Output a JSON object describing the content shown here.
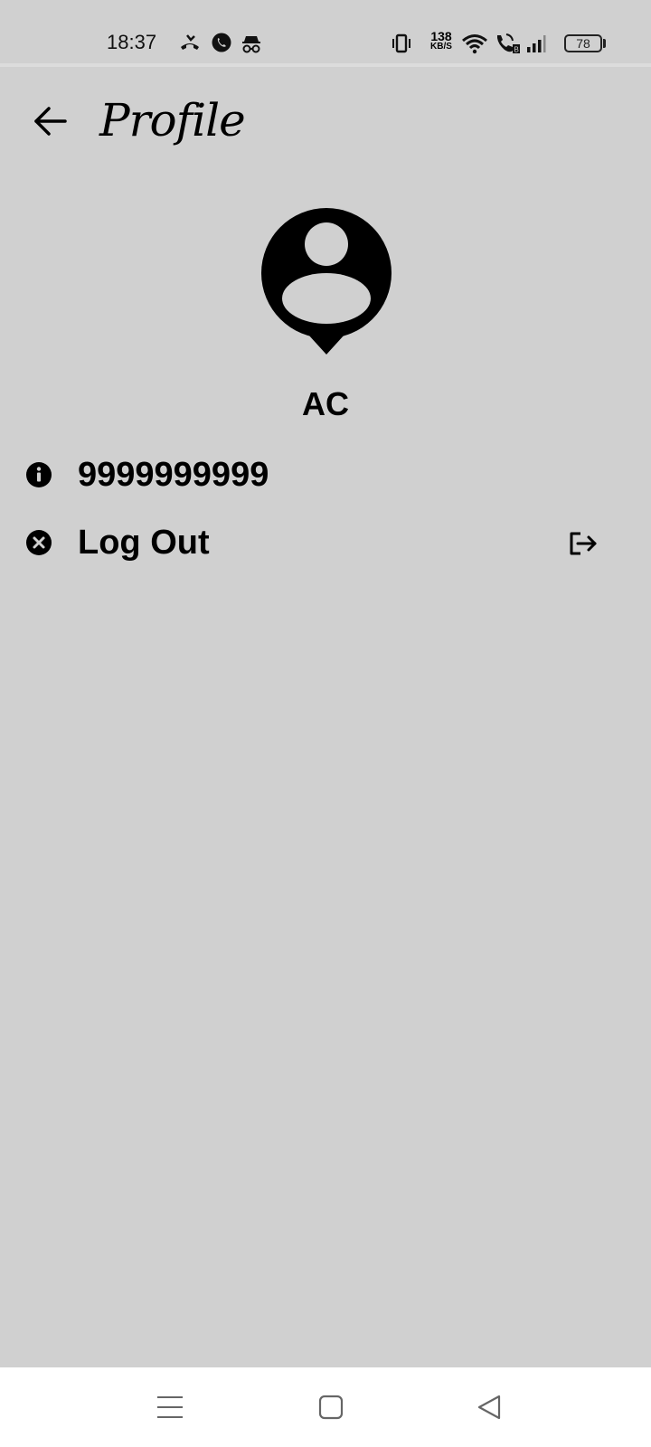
{
  "status_bar": {
    "time": "18:37",
    "net_speed_value": "138",
    "net_speed_unit": "KB/S",
    "battery": "78",
    "icons": [
      "missed-call-icon",
      "whatsapp-icon",
      "incognito-icon",
      "vibrate-icon",
      "wifi-icon",
      "volte-call-icon",
      "signal-icon",
      "battery-icon"
    ]
  },
  "header": {
    "title": "Profile",
    "back_icon": "arrow-left-icon"
  },
  "profile": {
    "avatar_icon": "user-pin-icon",
    "name": "AC"
  },
  "rows": [
    {
      "icon": "info-icon",
      "label": "9999999999"
    },
    {
      "icon": "cancel-circle-icon",
      "label": "Log Out",
      "trailing_icon": "logout-icon"
    }
  ],
  "nav_bar": {
    "icons": [
      "menu-icon",
      "home-square-icon",
      "back-triangle-icon"
    ]
  },
  "colors": {
    "background": "#d0d0d0",
    "nav_background": "#ffffff",
    "text": "#000000"
  }
}
